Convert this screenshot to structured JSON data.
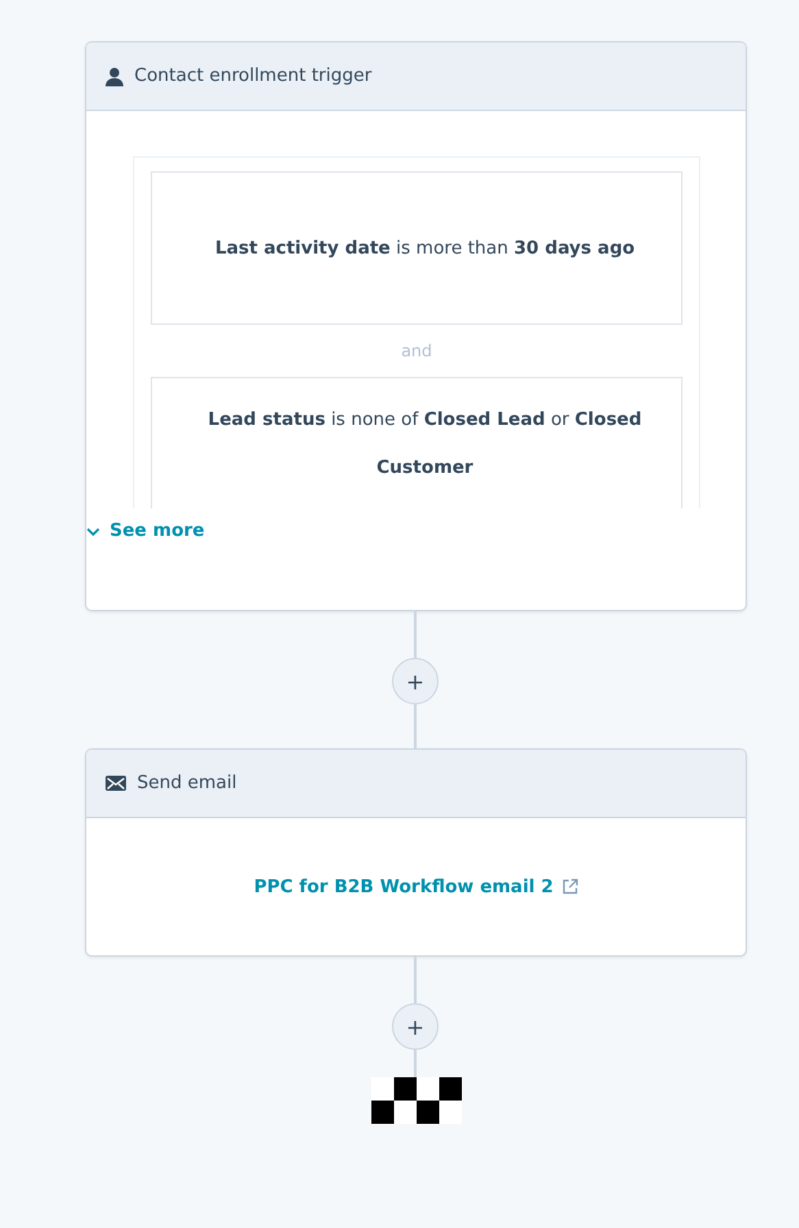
{
  "trigger_card": {
    "title": "Contact enrollment trigger",
    "conditions": [
      "**Last activity date** is more than **30 days ago**",
      "**Lead status** is none of **Closed Lead** or **Closed  Customer**"
    ],
    "joiner": "and",
    "see_more": "See more"
  },
  "add_buttons": [
    "+",
    "+"
  ],
  "email_card": {
    "title": "Send email",
    "email_link": "PPC for B2B Workflow email 2"
  }
}
